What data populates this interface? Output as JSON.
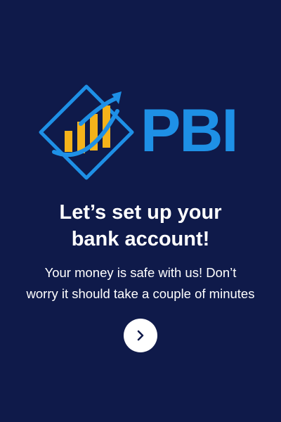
{
  "logo": {
    "text": "PBI",
    "colors": {
      "primary": "#1e90e6",
      "accent": "#f5b21a"
    }
  },
  "onboarding": {
    "headline_line1": "Let’s set up your",
    "headline_line2": "bank account!",
    "subtext_line1": "Your money is safe with us! Don’t",
    "subtext_line2": "worry it should take a couple of minutes"
  },
  "next_button": {
    "icon": "chevron-right-icon"
  },
  "theme": {
    "background": "#0f1a4a",
    "text": "#ffffff"
  }
}
